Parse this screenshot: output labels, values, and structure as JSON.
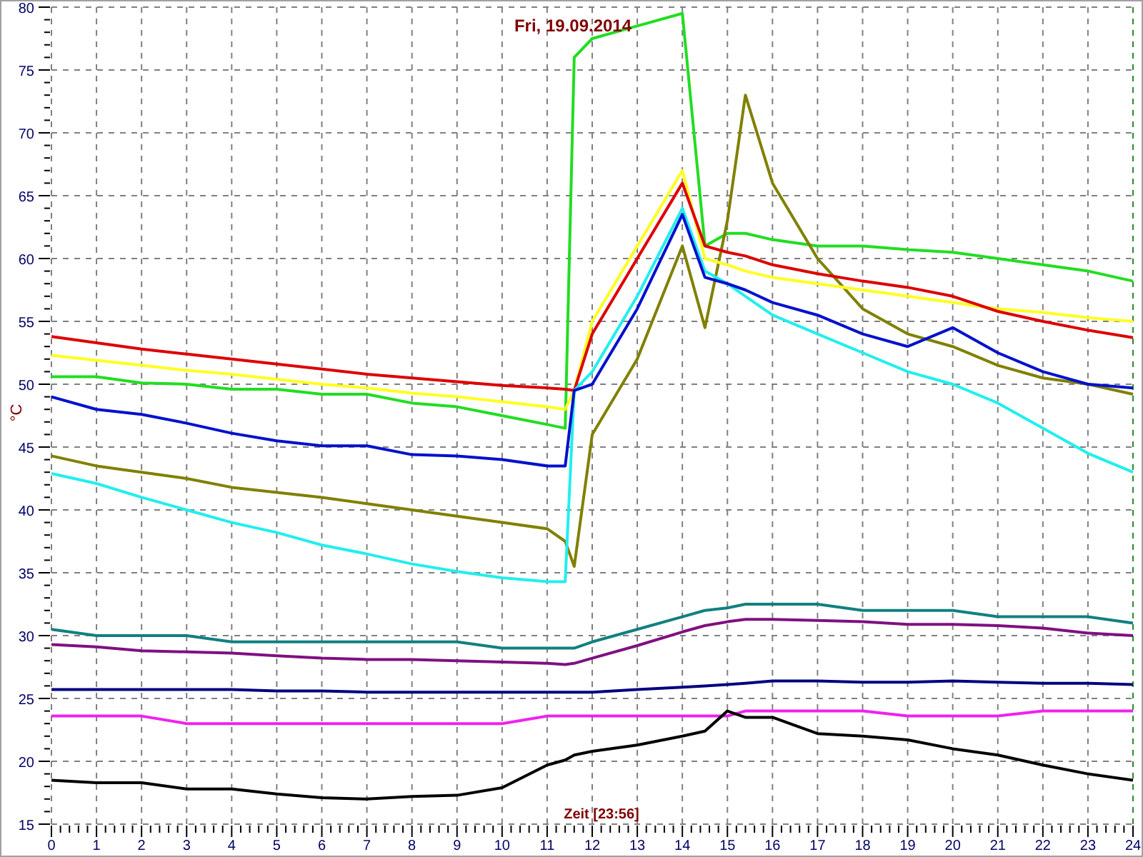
{
  "chart_data": {
    "type": "line",
    "grid": true,
    "title": "Fri, 19.09.2014",
    "xlabel": "Zeit [23:56]",
    "ylabel": "°C",
    "xlim": [
      0,
      24
    ],
    "ylim": [
      15,
      80
    ],
    "xticks": [
      0,
      1,
      2,
      3,
      4,
      5,
      6,
      7,
      8,
      9,
      10,
      11,
      12,
      13,
      14,
      15,
      16,
      17,
      18,
      19,
      20,
      21,
      22,
      23,
      24
    ],
    "yticks": [
      15,
      20,
      25,
      30,
      35,
      40,
      45,
      50,
      55,
      60,
      65,
      70,
      75,
      80
    ],
    "x": [
      0,
      1,
      2,
      3,
      4,
      5,
      6,
      7,
      8,
      9,
      10,
      11,
      11.4,
      11.6,
      12,
      13,
      14,
      14.5,
      15,
      15.4,
      16,
      17,
      18,
      19,
      20,
      21,
      22,
      23,
      24
    ],
    "series": [
      {
        "color": "#22dd22",
        "values": [
          50.6,
          50.6,
          50.1,
          50.0,
          49.6,
          49.6,
          49.2,
          49.2,
          48.5,
          48.2,
          47.5,
          46.8,
          46.5,
          76,
          77.5,
          78.5,
          79.5,
          61,
          62,
          62,
          61.5,
          61,
          61,
          60.7,
          60.5,
          60,
          59.5,
          59,
          58.2
        ]
      },
      {
        "color": "#808000",
        "values": [
          44.3,
          43.5,
          43,
          42.5,
          41.8,
          41.4,
          41,
          40.5,
          40,
          39.5,
          39,
          38.5,
          37.5,
          35.5,
          46,
          52,
          61,
          54.5,
          63,
          73,
          66,
          60,
          56,
          54,
          53,
          51.5,
          50.5,
          50,
          49.2
        ]
      },
      {
        "color": "#ffff22",
        "values": [
          52.3,
          51.9,
          51.5,
          51.1,
          50.8,
          50.4,
          50.0,
          49.7,
          49.3,
          49.0,
          48.6,
          48.2,
          48.0,
          49.5,
          55,
          61,
          67,
          60,
          59.5,
          59,
          58.5,
          58,
          57.5,
          57,
          56.5,
          56,
          55.7,
          55.3,
          55
        ]
      },
      {
        "color": "#dd0000",
        "values": [
          53.8,
          53.3,
          52.8,
          52.4,
          52,
          51.6,
          51.2,
          50.8,
          50.5,
          50.2,
          49.9,
          49.7,
          49.6,
          49.5,
          54,
          60,
          66,
          61,
          60.5,
          60.2,
          59.5,
          58.8,
          58.2,
          57.7,
          57,
          55.8,
          55,
          54.3,
          53.7
        ]
      },
      {
        "color": "#22eeee",
        "values": [
          42.9,
          42.1,
          41,
          40,
          39,
          38.2,
          37.2,
          36.5,
          35.7,
          35.1,
          34.6,
          34.3,
          34.3,
          49.5,
          51,
          57,
          64,
          59,
          58,
          57,
          55.5,
          54,
          52.5,
          51,
          50,
          48.5,
          46.5,
          44.5,
          43
        ]
      },
      {
        "color": "#0011cc",
        "values": [
          49,
          48,
          47.6,
          46.9,
          46.1,
          45.5,
          45.1,
          45.1,
          44.4,
          44.3,
          44,
          43.5,
          43.5,
          49.5,
          50,
          56,
          63.5,
          58.5,
          58,
          57.5,
          56.5,
          55.5,
          54,
          53,
          54.5,
          52.5,
          51,
          50,
          49.7
        ]
      },
      {
        "color": "#118080",
        "values": [
          30.5,
          30,
          30,
          30,
          29.5,
          29.5,
          29.5,
          29.5,
          29.5,
          29.5,
          29,
          29,
          29,
          29,
          29.5,
          30.5,
          31.5,
          32,
          32.2,
          32.5,
          32.5,
          32.5,
          32,
          32,
          32,
          31.5,
          31.5,
          31.5,
          31
        ]
      },
      {
        "color": "#801080",
        "values": [
          29.3,
          29.1,
          28.8,
          28.7,
          28.6,
          28.4,
          28.2,
          28.1,
          28.1,
          28,
          27.9,
          27.8,
          27.7,
          27.8,
          28.2,
          29.2,
          30.3,
          30.8,
          31.1,
          31.3,
          31.3,
          31.2,
          31.1,
          30.9,
          30.9,
          30.8,
          30.6,
          30.2,
          30
        ]
      },
      {
        "color": "#000080",
        "values": [
          25.7,
          25.7,
          25.7,
          25.7,
          25.7,
          25.6,
          25.6,
          25.5,
          25.5,
          25.5,
          25.5,
          25.5,
          25.5,
          25.5,
          25.5,
          25.7,
          25.9,
          26,
          26.1,
          26.2,
          26.4,
          26.4,
          26.3,
          26.3,
          26.4,
          26.3,
          26.2,
          26.2,
          26.1
        ]
      },
      {
        "color": "#ee22ee",
        "values": [
          23.6,
          23.6,
          23.6,
          23,
          23,
          23,
          23,
          23,
          23,
          23,
          23,
          23.6,
          23.6,
          23.6,
          23.6,
          23.6,
          23.6,
          23.6,
          23.6,
          24,
          24,
          24,
          24,
          23.6,
          23.6,
          23.6,
          24,
          24,
          24
        ]
      },
      {
        "color": "#000000",
        "values": [
          18.5,
          18.3,
          18.3,
          17.8,
          17.8,
          17.4,
          17.1,
          17,
          17.2,
          17.3,
          17.9,
          19.7,
          20.1,
          20.5,
          20.8,
          21.3,
          22,
          22.4,
          24,
          23.5,
          23.5,
          22.2,
          22,
          21.7,
          21,
          20.5,
          19.7,
          19,
          18.5
        ]
      }
    ]
  }
}
